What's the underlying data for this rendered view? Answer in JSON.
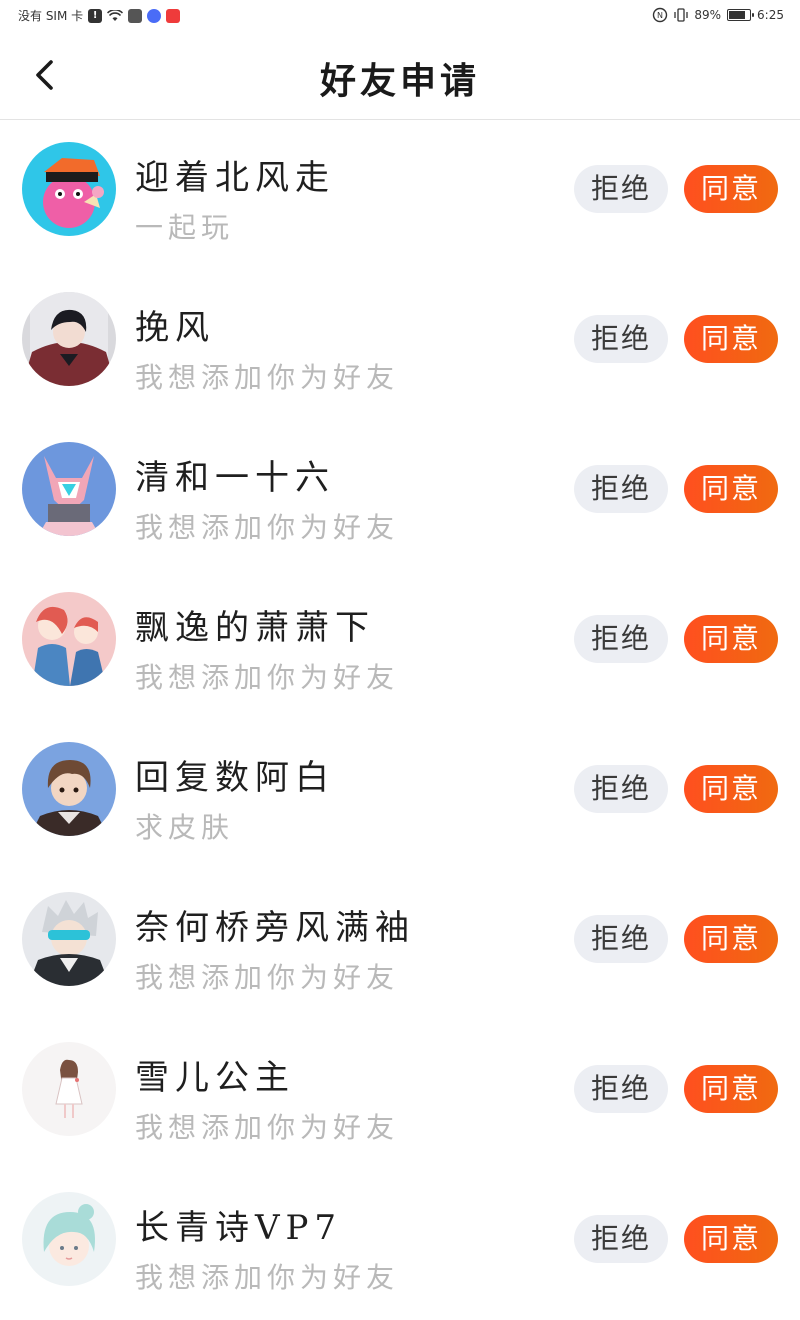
{
  "status_bar": {
    "carrier": "没有 SIM 卡",
    "battery_percent": "89%",
    "battery_level": 0.89,
    "time": "6:25",
    "icons": [
      "alert-icon",
      "wifi-icon",
      "app-notification-icon",
      "music-icon",
      "red-app-icon",
      "nfc-icon",
      "vibrate-icon",
      "battery-icon"
    ]
  },
  "header": {
    "title": "好友申请",
    "back_icon": "chevron-left-icon"
  },
  "requests": [
    {
      "name": "迎着北风走",
      "message": "一起玩",
      "reject": "拒绝",
      "accept": "同意"
    },
    {
      "name": "挽风",
      "message": "我想添加你为好友",
      "reject": "拒绝",
      "accept": "同意"
    },
    {
      "name": "清和一十六",
      "message": "我想添加你为好友",
      "reject": "拒绝",
      "accept": "同意"
    },
    {
      "name": "飘逸的萧萧下",
      "message": "我想添加你为好友",
      "reject": "拒绝",
      "accept": "同意"
    },
    {
      "name": "回复数阿白",
      "message": "求皮肤",
      "reject": "拒绝",
      "accept": "同意"
    },
    {
      "name": "奈何桥旁风满袖",
      "message": "我想添加你为好友",
      "reject": "拒绝",
      "accept": "同意"
    },
    {
      "name": "雪儿公主",
      "message": "我想添加你为好友",
      "reject": "拒绝",
      "accept": "同意"
    },
    {
      "name": "长青诗VP7",
      "message": "我想添加你为好友",
      "reject": "拒绝",
      "accept": "同意"
    }
  ],
  "colors": {
    "accept_button": "#f4511e",
    "reject_button": "#eceef3",
    "secondary_text": "#b9b9b9"
  }
}
